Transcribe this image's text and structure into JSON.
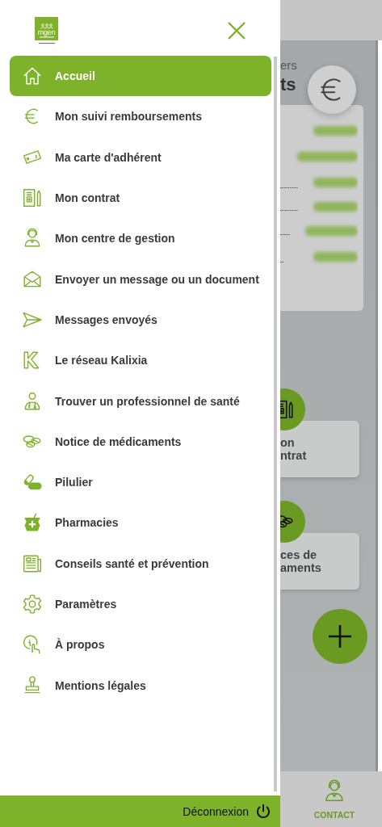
{
  "logo": {
    "text": "mgen"
  },
  "menu": {
    "items": [
      {
        "label": "Accueil",
        "selected": true
      },
      {
        "label": "Mon suivi remboursements",
        "selected": false
      },
      {
        "label": "Ma carte d'adhérent",
        "selected": false
      },
      {
        "label": "Mon contrat",
        "selected": false
      },
      {
        "label": "Mon centre de gestion",
        "selected": false
      },
      {
        "label": "Envoyer un message ou un document",
        "selected": false
      },
      {
        "label": "Messages envoyés",
        "selected": false
      },
      {
        "label": "Le réseau Kalixia",
        "selected": false
      },
      {
        "label": "Trouver un professionnel de santé",
        "selected": false
      },
      {
        "label": "Notice de médicaments",
        "selected": false
      },
      {
        "label": "Pilulier",
        "selected": false
      },
      {
        "label": "Pharmacies",
        "selected": false
      },
      {
        "label": "Conseils santé et prévention",
        "selected": false
      },
      {
        "label": "Paramètres",
        "selected": false
      },
      {
        "label": "À propos",
        "selected": false
      },
      {
        "label": "Mentions légales",
        "selected": false
      }
    ]
  },
  "footer": {
    "logout": "Déconnexion"
  },
  "background": {
    "subtitle": "ers",
    "title": "ts",
    "tiles": [
      {
        "lines": [
          "on",
          "ntrat"
        ]
      },
      {
        "lines": [
          "ces de",
          "aments"
        ]
      }
    ],
    "nav": {
      "label": "CONTACT"
    }
  }
}
